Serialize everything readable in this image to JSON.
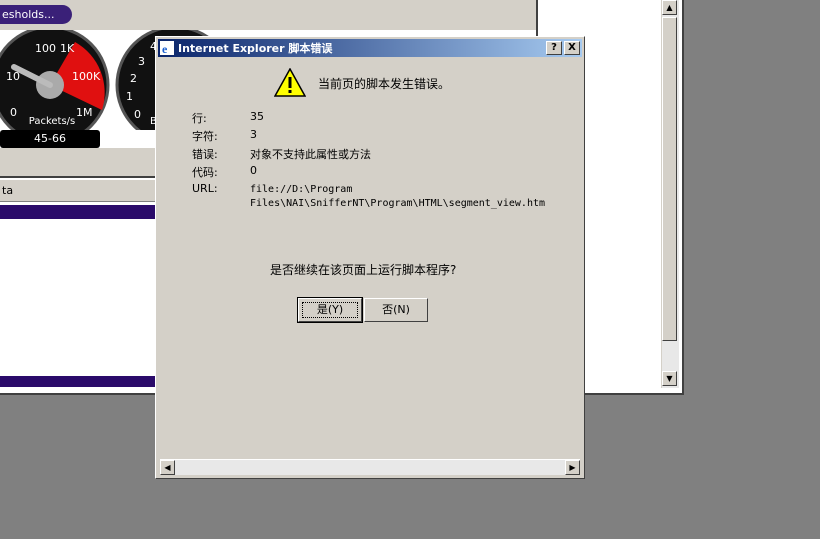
{
  "background": {
    "thresholds_label": "esholds...",
    "gauge1": {
      "ticks": [
        "100",
        "1K",
        "10",
        "100K",
        "0",
        "1M"
      ],
      "caption": "Packets/s",
      "readout": "45-66",
      "level_fraction": 0.42
    },
    "gauge2": {
      "ticks": [
        "4",
        "3",
        "2",
        "1",
        "0"
      ],
      "caption": "B"
    },
    "list_header": "ta"
  },
  "dialog": {
    "title": "Internet Explorer 脚本错误",
    "help_btn": "?",
    "close_btn": "X",
    "heading": "当前页的脚本发生错误。",
    "rows": [
      {
        "label": "行:",
        "value": "35"
      },
      {
        "label": "字符:",
        "value": "3"
      },
      {
        "label": "错误:",
        "value": "对象不支持此属性或方法"
      },
      {
        "label": "代码:",
        "value": "0"
      },
      {
        "label": "URL:",
        "value_line1": "file://D:\\Program",
        "value_line2": "Files\\NAI\\SnifferNT\\Program\\HTML\\segment_view.htm"
      }
    ],
    "question": "是否继续在该页面上运行脚本程序?",
    "yes_label": "是(Y)",
    "no_label": "否(N)"
  },
  "colors": {
    "desktop": "#808080",
    "titlebar_start": "#0a246a",
    "titlebar_end": "#a6caf0",
    "gauge_red": "#e01010",
    "accent_purple": "#2a0a6a"
  }
}
